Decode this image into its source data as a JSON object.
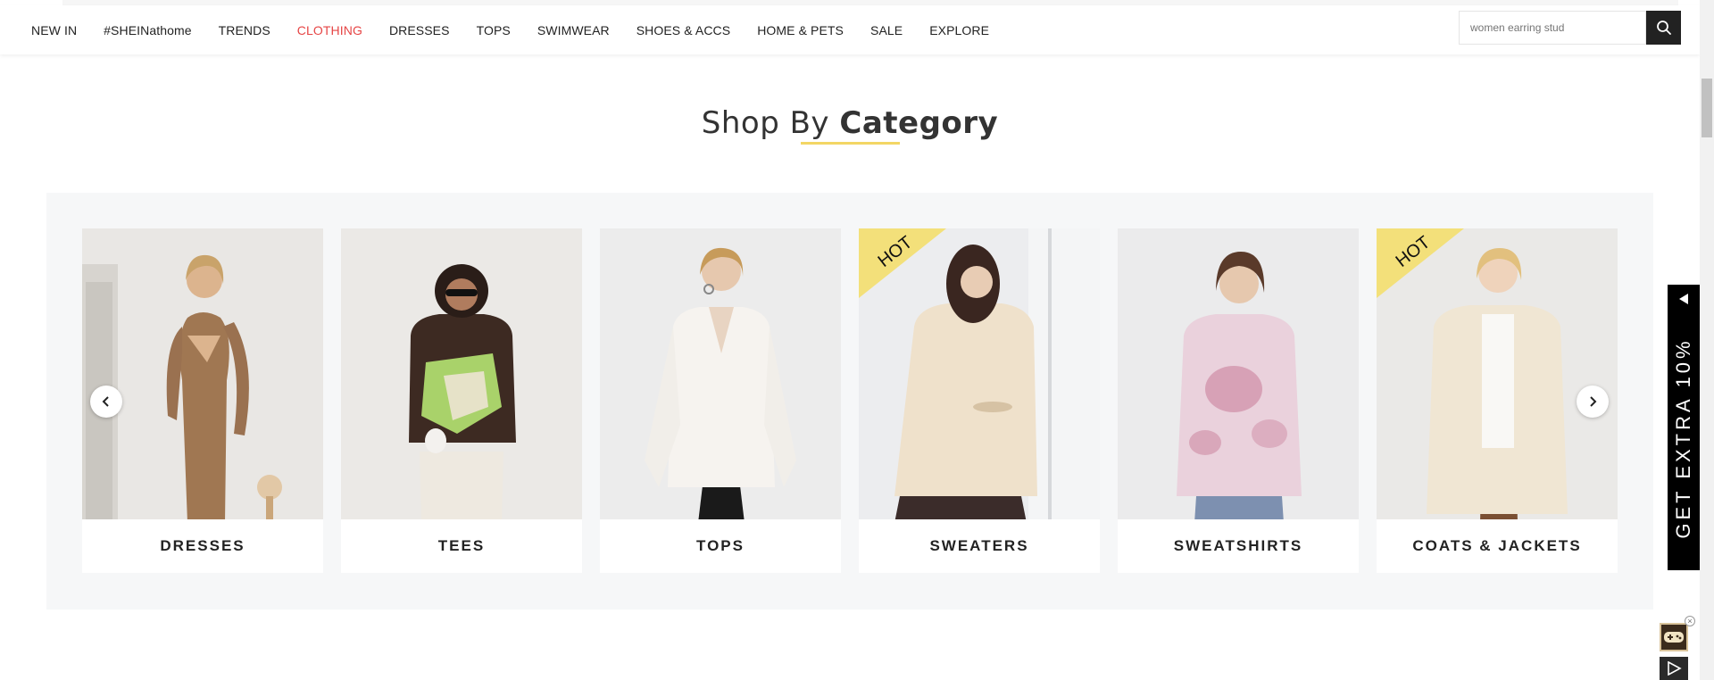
{
  "nav": {
    "items": [
      {
        "label": "NEW IN",
        "active": false
      },
      {
        "label": "#SHEINathome",
        "active": false
      },
      {
        "label": "TRENDS",
        "active": false
      },
      {
        "label": "CLOTHING",
        "active": true
      },
      {
        "label": "DRESSES",
        "active": false
      },
      {
        "label": "TOPS",
        "active": false
      },
      {
        "label": "SWIMWEAR",
        "active": false
      },
      {
        "label": "SHOES & ACCS",
        "active": false
      },
      {
        "label": "HOME & PETS",
        "active": false
      },
      {
        "label": "SALE",
        "active": false
      },
      {
        "label": "EXPLORE",
        "active": false
      }
    ],
    "active_color": "#e64545",
    "search": {
      "placeholder": "women earring stud",
      "icon": "search-icon"
    }
  },
  "section": {
    "title_light": "Shop By",
    "title_bold": "Category",
    "underline_color": "#f3d664"
  },
  "categories": [
    {
      "label": "DRESSES",
      "hot": false
    },
    {
      "label": "TEES",
      "hot": false
    },
    {
      "label": "TOPS",
      "hot": false
    },
    {
      "label": "SWEATERS",
      "hot": true
    },
    {
      "label": "SWEATSHIRTS",
      "hot": false
    },
    {
      "label": "COATS & JACKETS",
      "hot": true
    }
  ],
  "hot_badge": {
    "text": "HOT",
    "color": "#f3e07a"
  },
  "carousel": {
    "prev_icon": "chevron-left-icon",
    "next_icon": "chevron-right-icon"
  },
  "promo": {
    "text": "GET EXTRA 10%",
    "icon": "triangle-left-icon"
  },
  "widgets": {
    "game_icon": "gamepad-icon",
    "close_icon": "close-icon",
    "play_icon": "play-icon"
  }
}
